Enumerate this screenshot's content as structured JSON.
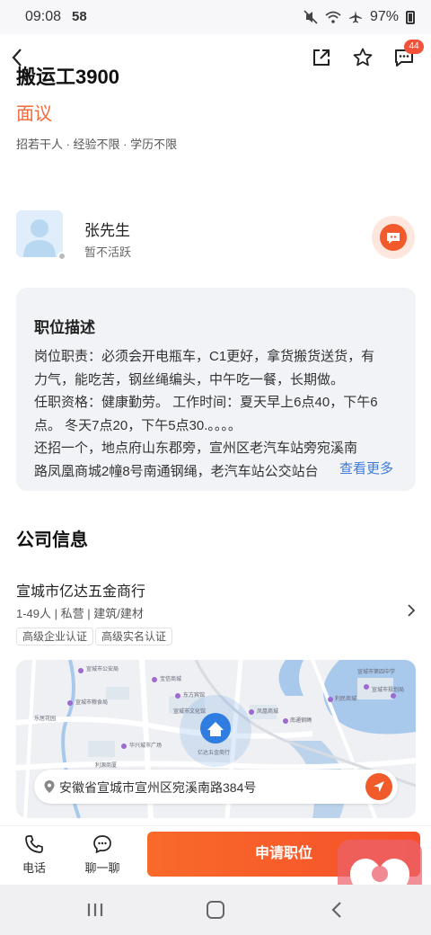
{
  "status_bar": {
    "time": "09:08",
    "carrier_mark": "58",
    "battery": "97%"
  },
  "header": {
    "message_badge": "44"
  },
  "job": {
    "title": "搬运工3900",
    "salary": "面议",
    "tags": "招若干人 · 经验不限 · 学历不限"
  },
  "recruiter": {
    "name": "张先生",
    "status": "暂不活跃"
  },
  "description": {
    "title": "职位描述",
    "lines": [
      "岗位职责：必须会开电瓶车，C1更好，拿货搬货送货，有",
      "力气，能吃苦，钢丝绳编头，中午吃一餐，长期做。",
      "任职资格：健康勤劳。 工作时间：夏天早上6点40，下午6",
      "点。 冬天7点20，下午5点30.。。。。",
      "还招一个，地点府山东郡旁，宣州区老汽车站旁宛溪南",
      "路凤凰商城2幢8号南通钢绳，老汽车站公交站台"
    ],
    "more_label": "查看更多"
  },
  "company": {
    "heading": "公司信息",
    "name": "宣城市亿达五金商行",
    "meta": "1-49人 | 私营 | 建筑/建材",
    "certs": [
      "高级企业认证",
      "高级实名认证"
    ]
  },
  "map": {
    "address": "安徽省宣城市宣州区宛溪南路384号",
    "labels": {
      "l1": "宣城市公安局",
      "l2": "宝信商城",
      "l3": "宣城市第四中学",
      "l4": "宣城市粮食局",
      "l5": "东方宾馆",
      "l6": "凤凰商城",
      "l7": "利民商城",
      "l8": "宣城市规划局",
      "l9": "华兴城市广场",
      "l10": "乐居花园",
      "l11": "利源商厦",
      "l12": "南通钢绳",
      "l13": "宣城市文化馆",
      "l14": "亿达五金商行"
    }
  },
  "bottom_bar": {
    "phone_label": "电话",
    "chat_label": "聊一聊",
    "apply_label": "申请职位"
  },
  "colors": {
    "accent": "#f26a3a",
    "link": "#3c7be0",
    "badge": "#f0533a"
  }
}
